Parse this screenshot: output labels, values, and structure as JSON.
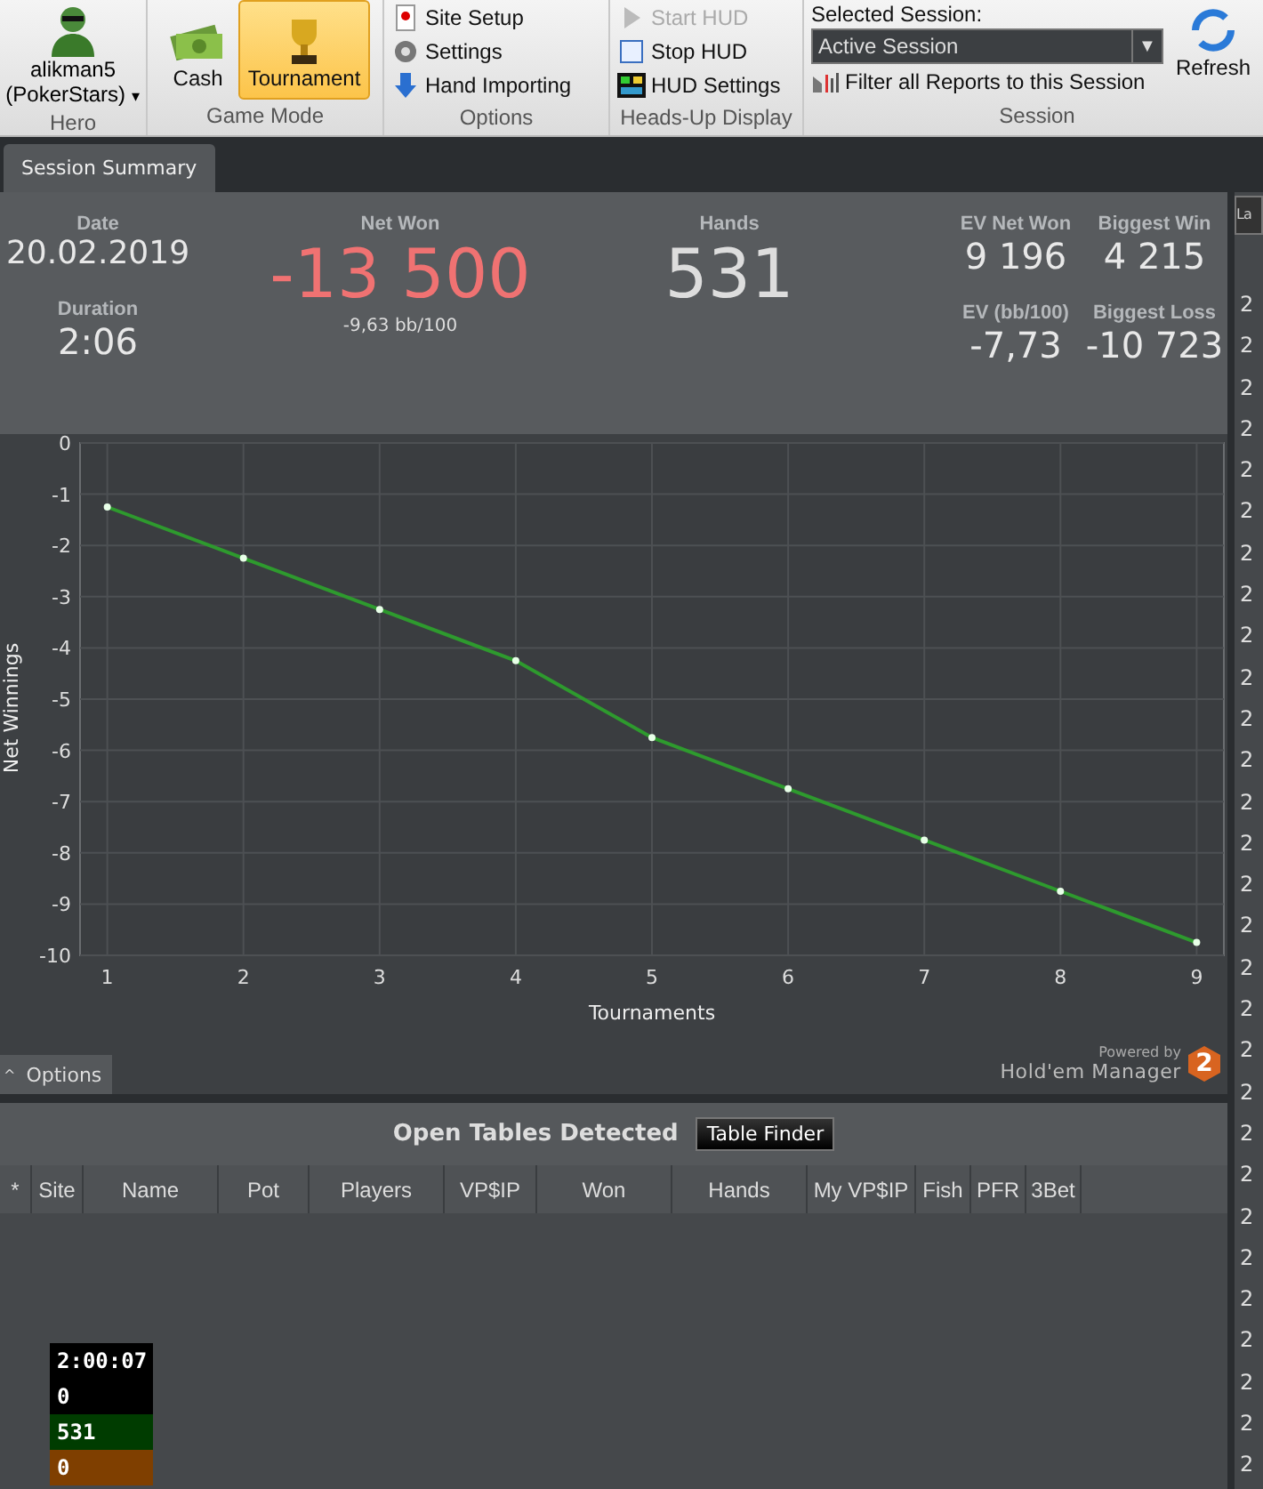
{
  "ribbon": {
    "hero": {
      "name": "alikman5",
      "site": "(PokerStars)",
      "caret": "▾",
      "label": "Hero"
    },
    "game_mode": {
      "label": "Game Mode",
      "options": [
        {
          "label": "Cash",
          "selected": false
        },
        {
          "label": "Tournament",
          "selected": true
        }
      ]
    },
    "options": {
      "label": "Options",
      "items": [
        {
          "label": "Site Setup",
          "kind": "site"
        },
        {
          "label": "Settings",
          "kind": "gear"
        },
        {
          "label": "Hand Importing",
          "kind": "import"
        }
      ]
    },
    "hud": {
      "label": "Heads-Up Display",
      "items": [
        {
          "label": "Start HUD",
          "kind": "start",
          "disabled": true
        },
        {
          "label": "Stop HUD",
          "kind": "stop",
          "disabled": false
        },
        {
          "label": "HUD Settings",
          "kind": "settings",
          "disabled": false
        }
      ]
    },
    "session": {
      "label": "Session",
      "caption": "Selected Session:",
      "value": "Active Session",
      "caret": "▼",
      "filter": "Filter all Reports to this Session",
      "refresh": "Refresh"
    }
  },
  "tabs": [
    {
      "label": "Session Summary",
      "selected": true
    }
  ],
  "summary": {
    "date": {
      "label": "Date",
      "value": "20.02.2019"
    },
    "duration": {
      "label": "Duration",
      "value": "2:06"
    },
    "net_won": {
      "label": "Net Won",
      "value": "-13 500",
      "sub": "-9,63 bb/100"
    },
    "hands": {
      "label": "Hands",
      "value": "531"
    },
    "ev_net_won": {
      "label": "EV Net Won",
      "value": "9 196"
    },
    "biggest_win": {
      "label": "Biggest Win",
      "value": "4 215"
    },
    "ev_bb": {
      "label": "EV (bb/100)",
      "value": "-7,73"
    },
    "biggest_loss": {
      "label": "Biggest Loss",
      "value": "-10 723"
    }
  },
  "chart_data": {
    "type": "line",
    "xlabel": "Tournaments",
    "ylabel": "Net Winnings",
    "x": [
      1,
      2,
      3,
      4,
      5,
      6,
      7,
      8,
      9
    ],
    "grid": true,
    "series": [
      {
        "color": "#2e9a2e",
        "marker": "circle",
        "values": [
          -1.25,
          -2.25,
          -3.25,
          -4.25,
          -5.75,
          -6.75,
          -7.75,
          -8.75,
          -9.75
        ]
      }
    ],
    "xlim": [
      0.8,
      9.2
    ],
    "ylim": [
      -10,
      0
    ],
    "xticks": [
      1,
      2,
      3,
      4,
      5,
      6,
      7,
      8,
      9
    ],
    "yticks": [
      0,
      -1,
      -2,
      -3,
      -4,
      -5,
      -6,
      -7,
      -8,
      -9,
      -10
    ]
  },
  "options_button": "Options",
  "options_caret": "^",
  "branding": {
    "powered": "Powered by",
    "name": "Hold'em Manager",
    "badge": "2"
  },
  "open_tables": {
    "title": "Open Tables Detected",
    "button": "Table Finder",
    "columns": [
      "*",
      "Site",
      "Name",
      "Pot",
      "Players",
      "VP$IP",
      "Won",
      "Hands",
      "My VP$IP",
      "Fish",
      "PFR",
      "3Bet"
    ]
  },
  "hud_overlay": [
    {
      "text": "2:00:07",
      "color": "#000000"
    },
    {
      "text": "0",
      "color": "#000000"
    },
    {
      "text": "531",
      "color": "#003c00"
    },
    {
      "text": "0",
      "color": "#7f3f00"
    }
  ],
  "side_panel": {
    "header": "La",
    "rows": [
      "2",
      "2",
      "2",
      "2",
      "2",
      "2",
      "2",
      "2",
      "2",
      "2",
      "2",
      "2",
      "2",
      "2",
      "2",
      "2",
      "2",
      "2",
      "2",
      "2",
      "2",
      "2",
      "2",
      "2",
      "2",
      "2",
      "2",
      "2",
      "2"
    ]
  }
}
